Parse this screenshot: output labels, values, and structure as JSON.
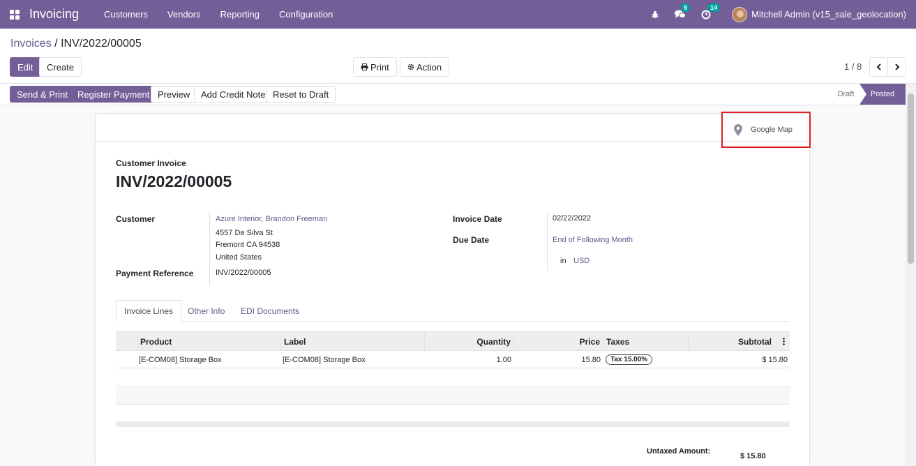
{
  "navbar": {
    "brand": "Invoicing",
    "menu": [
      "Customers",
      "Vendors",
      "Reporting",
      "Configuration"
    ],
    "messages_count": "5",
    "activities_count": "14",
    "user": "Mitchell Admin (v15_sale_geolocation)"
  },
  "breadcrumb": {
    "parent": "Invoices",
    "separator": "/",
    "current": "INV/2022/00005"
  },
  "control": {
    "edit": "Edit",
    "create": "Create",
    "print": "Print",
    "action": "Action",
    "pager": "1 / 8"
  },
  "statusbar": {
    "send_print": "Send & Print",
    "register_payment": "Register Payment",
    "preview": "Preview",
    "credit_note": "Add Credit Note",
    "reset": "Reset to Draft",
    "stages": [
      "Draft",
      "Posted"
    ],
    "active_stage": "Posted"
  },
  "form": {
    "google_map": "Google Map",
    "type_label": "Customer Invoice",
    "name": "INV/2022/00005",
    "customer_label": "Customer",
    "customer": "Azure Interior, Brandon Freeman",
    "address": [
      "4557 De Silva St",
      "Fremont CA 94538",
      "United States"
    ],
    "payment_ref_label": "Payment Reference",
    "payment_ref": "INV/2022/00005",
    "invoice_date_label": "Invoice Date",
    "invoice_date": "02/22/2022",
    "due_date_label": "Due Date",
    "due_date": "End of Following Month",
    "currency_prefix": "in",
    "currency": "USD"
  },
  "tabs": [
    "Invoice Lines",
    "Other Info",
    "EDI Documents"
  ],
  "table": {
    "columns": [
      "Product",
      "Label",
      "Quantity",
      "Price",
      "Taxes",
      "Subtotal"
    ],
    "rows": [
      {
        "product": "[E-COM08] Storage Box",
        "label": "[E-COM08] Storage Box",
        "quantity": "1.00",
        "price": "15.80",
        "tax": "Tax 15.00%",
        "subtotal": "$ 15.80"
      }
    ]
  },
  "totals": {
    "untaxed_label": "Untaxed Amount:",
    "untaxed": "$ 15.80"
  },
  "colors": {
    "brand": "#735e98",
    "highlight": "#e21d24",
    "link": "#5e5a8a"
  }
}
